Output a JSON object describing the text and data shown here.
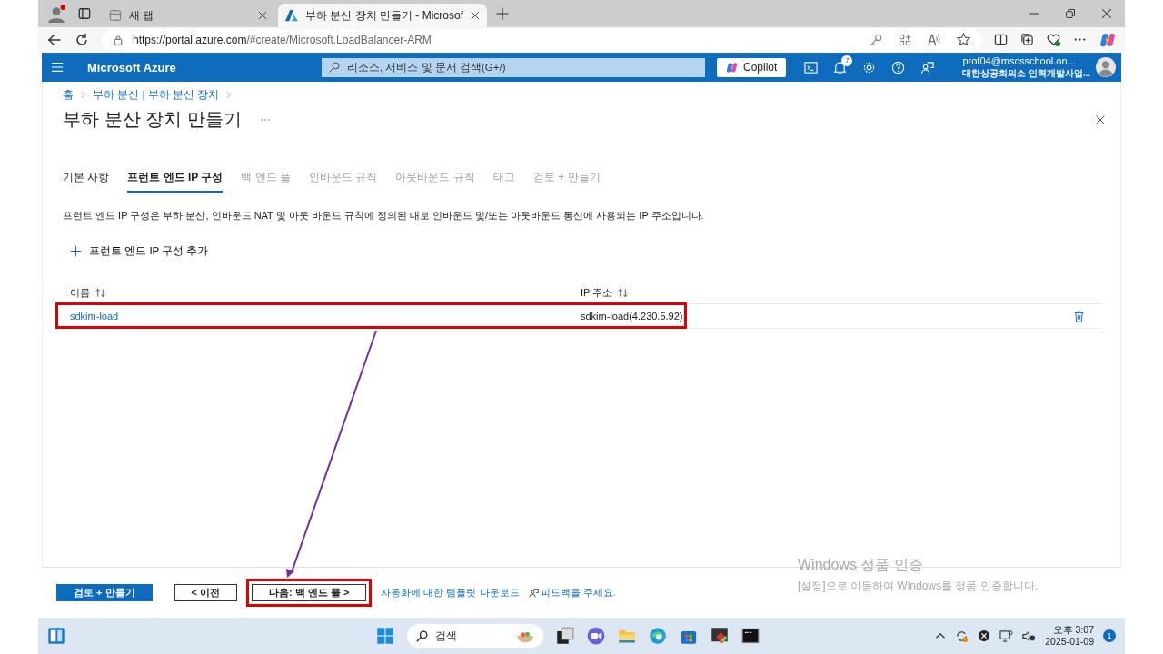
{
  "browser": {
    "tabs": [
      {
        "title": "새 탭",
        "selected": false
      },
      {
        "title": "부하 분산 장치 만들기 - Microsof",
        "selected": true
      }
    ],
    "url_host": "https://portal.azure.com",
    "url_path": "/#create/Microsoft.LoadBalancer-ARM"
  },
  "portal": {
    "brand": "Microsoft Azure",
    "search_placeholder": "리소스, 서비스 및 문서 검색(G+/)",
    "copilot": "Copilot",
    "notification_count": "7",
    "account_email": "prof04@mscsschool.on...",
    "account_org": "대한상공회의소 인력개발사업..."
  },
  "breadcrumb": [
    "홈",
    "부하 분산 | 부하 분산 장치"
  ],
  "page_title": "부하 분산 장치 만들기",
  "steps": [
    {
      "label": "기본 사항",
      "selected": false,
      "disabled": false
    },
    {
      "label": "프런트 엔드 IP 구성",
      "selected": true,
      "disabled": false
    },
    {
      "label": "백 엔드 풀",
      "selected": false,
      "disabled": true
    },
    {
      "label": "인바운드 규칙",
      "selected": false,
      "disabled": true
    },
    {
      "label": "아웃바운드 규칙",
      "selected": false,
      "disabled": true
    },
    {
      "label": "태그",
      "selected": false,
      "disabled": true
    },
    {
      "label": "검토 + 만들기",
      "selected": false,
      "disabled": true
    }
  ],
  "description": "프런트 엔드 IP 구성은 부하 분산, 인바운드 NAT 및 아웃 바운드 규칙에 정의된 대로 인바운드 및/또는 아웃바운드 통신에 사용되는 IP 주소입니다.",
  "add_button": "프런트 엔드 IP 구성 추가",
  "table": {
    "columns": [
      "이름",
      "IP 주소"
    ],
    "rows": [
      {
        "name": "sdkim-load",
        "ip": "sdkim-load(4.230.5.92)",
        "highlighted": true
      }
    ]
  },
  "footer": {
    "buttons": [
      {
        "label": "검토 + 만들기",
        "kind": "primary",
        "highlighted": false
      },
      {
        "label": "< 이전",
        "kind": "secondary",
        "highlighted": false
      },
      {
        "label": "다음: 백 엔드 풀 >",
        "kind": "secondary",
        "highlighted": true
      }
    ],
    "template_link": "자동화에 대한 템플릿 다운로드",
    "feedback_link": "피드백을 주세요."
  },
  "activation": {
    "title": "Windows 정품 인증",
    "message": "[설정]으로 이동하여 Windows를 정품 인증합니다."
  },
  "taskbar": {
    "search_placeholder": "검색",
    "time": "오후 3:07",
    "date": "2025-01-09",
    "notification_count": "1"
  }
}
